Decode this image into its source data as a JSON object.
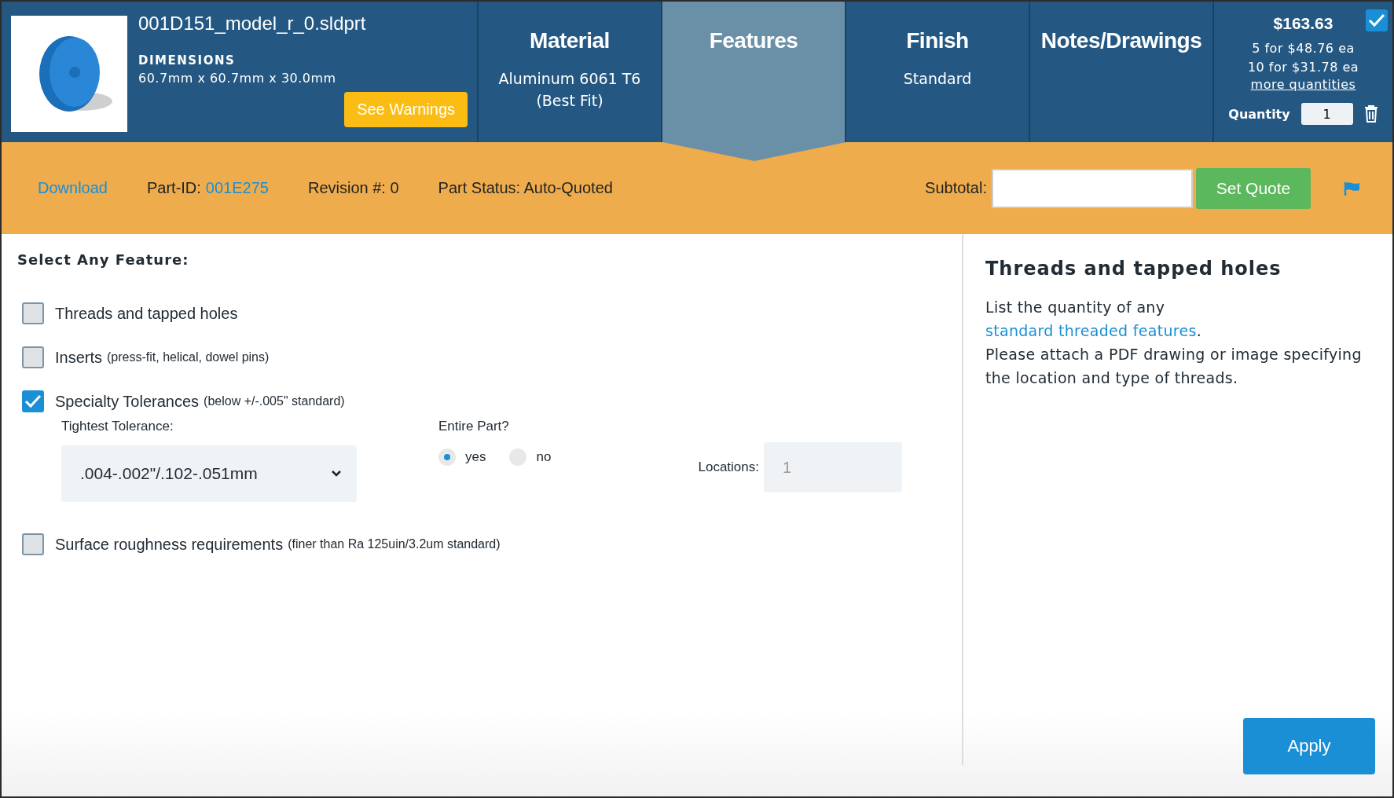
{
  "part": {
    "file_name": "001D151_model_r_0.sldprt",
    "dimensions_label": "DIMENSIONS",
    "dimensions": "60.7mm x 60.7mm x 30.0mm",
    "warnings_button": "See Warnings"
  },
  "tabs": [
    {
      "title": "Material",
      "value": "Aluminum 6061 T6\n(Best Fit)",
      "selected": false
    },
    {
      "title": "Features",
      "selected": true
    },
    {
      "title": "Finish",
      "value": "Standard",
      "selected": false
    },
    {
      "title": "Notes/Drawings",
      "selected": false
    }
  ],
  "pricing": {
    "price": "$163.63",
    "tiers": [
      "5 for $48.76 ea",
      "10 for $31.78 ea"
    ],
    "more_link": "more quantities",
    "quantity_label": "Quantity",
    "quantity": "1",
    "checked": true
  },
  "info_bar": {
    "download": "Download",
    "part_id_label": "Part-ID:",
    "part_id": "001E275",
    "revision": "Revision #: 0",
    "status": "Part Status: Auto-Quoted",
    "subtotal_label": "Subtotal:",
    "set_quote": "Set Quote"
  },
  "features": {
    "title": "Select Any Feature:",
    "items": [
      {
        "label": "Threads and tapped holes",
        "checked": false
      },
      {
        "label": "Inserts",
        "hint": "(press-fit, helical, dowel pins)",
        "checked": false
      },
      {
        "label": "Specialty Tolerances",
        "hint": "(below +/-.005\" standard)",
        "checked": true,
        "details": {
          "tolerance_label": "Tightest Tolerance:",
          "tolerance": ".004-.002\"/.102-.051mm",
          "entire_label": "Entire Part?",
          "options": [
            {
              "label": "yes",
              "selected": true
            },
            {
              "label": "no",
              "selected": false
            }
          ],
          "locations_label": "Locations:",
          "locations_placeholder": "1"
        }
      },
      {
        "label": "Surface roughness requirements",
        "hint": "(finer than Ra 125uin/3.2um standard)",
        "checked": false
      }
    ]
  },
  "help": {
    "title": "Threads and tapped holes",
    "intro": "List the quantity of any",
    "link": "standard threaded features",
    "after": ".",
    "note": "Please attach a PDF drawing or image specifying the location and type of threads."
  },
  "apply_button": "Apply"
}
